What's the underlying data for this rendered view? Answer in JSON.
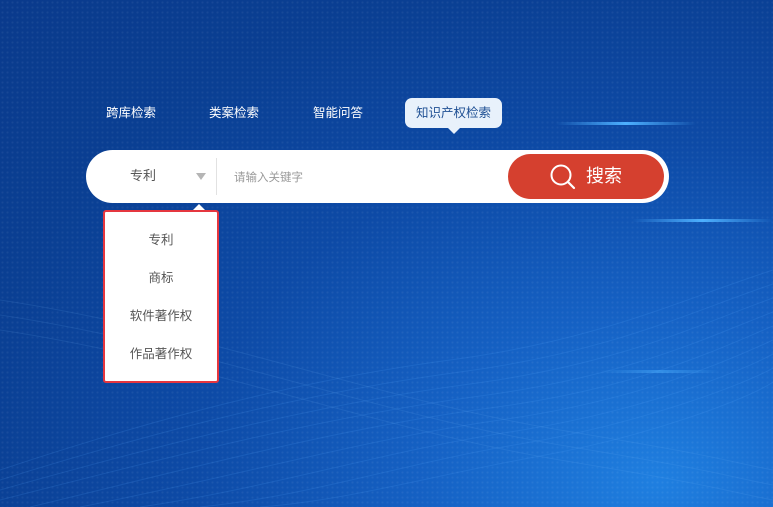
{
  "nav": {
    "tabs": [
      {
        "label": "跨库检索"
      },
      {
        "label": "类案检索"
      },
      {
        "label": "智能问答"
      },
      {
        "label": "知识产权检索"
      }
    ]
  },
  "search": {
    "type_selected": "专利",
    "placeholder": "请输入关键字",
    "button_label": "搜索"
  },
  "dropdown": {
    "options": [
      "专利",
      "商标",
      "软件著作权",
      "作品著作权"
    ]
  },
  "colors": {
    "accent": "#d5402f",
    "highlight_border": "#e5363f",
    "background": "#0d4aa6"
  },
  "icons": {
    "search": "magnifier-icon",
    "caret": "caret-down-icon"
  }
}
